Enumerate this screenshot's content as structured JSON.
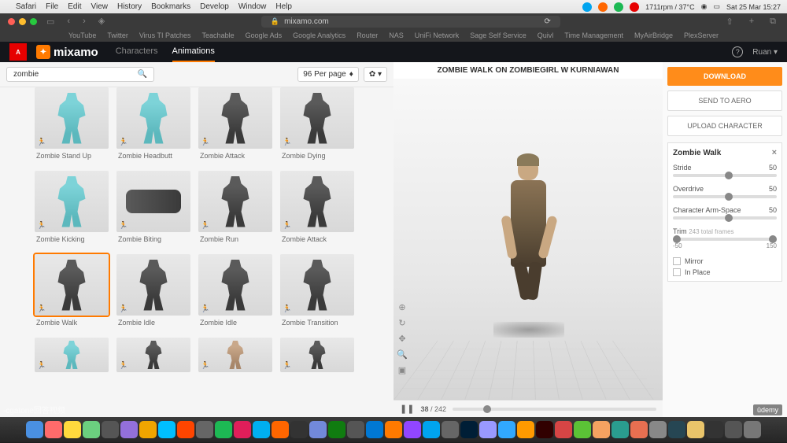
{
  "menubar": {
    "app": "Safari",
    "items": [
      "File",
      "Edit",
      "View",
      "History",
      "Bookmarks",
      "Develop",
      "Window",
      "Help"
    ],
    "status": "1711rpm / 37°C",
    "datetime": "Sat 25 Mar 15:27"
  },
  "browser": {
    "url": "mixamo.com",
    "bookmarks": [
      "YouTube",
      "Twitter",
      "Virus TI Patches",
      "Teachable",
      "Google Ads",
      "Google Analytics",
      "Router",
      "NAS",
      "UniFi Network",
      "Sage Self Service",
      "Quivl",
      "Time Management",
      "MyAirBridge",
      "PlexServer"
    ]
  },
  "header": {
    "logo_text": "mixamo",
    "tabs": [
      {
        "label": "Characters",
        "active": false
      },
      {
        "label": "Animations",
        "active": true
      }
    ],
    "user": "Ruan"
  },
  "search": {
    "query": "zombie",
    "per_page": "96 Per page"
  },
  "cards": [
    {
      "label": "Zombie Stand Up",
      "style": "fig-cyan",
      "short": false,
      "selected": false
    },
    {
      "label": "Zombie Headbutt",
      "style": "fig-cyan",
      "short": false,
      "selected": false
    },
    {
      "label": "Zombie Attack",
      "style": "fig-dark",
      "short": false,
      "selected": false
    },
    {
      "label": "Zombie Dying",
      "style": "fig-dark",
      "short": false,
      "selected": false
    },
    {
      "label": "Zombie Kicking",
      "style": "fig-cyan",
      "short": false,
      "selected": false
    },
    {
      "label": "Zombie Biting",
      "style": "fig-lying",
      "short": false,
      "selected": false
    },
    {
      "label": "Zombie Run",
      "style": "fig-dark",
      "short": false,
      "selected": false
    },
    {
      "label": "Zombie Attack",
      "style": "fig-dark",
      "short": false,
      "selected": false
    },
    {
      "label": "Zombie Walk",
      "style": "fig-dark",
      "short": false,
      "selected": true
    },
    {
      "label": "Zombie Idle",
      "style": "fig-dark",
      "short": false,
      "selected": false
    },
    {
      "label": "Zombie Idle",
      "style": "fig-dark",
      "short": false,
      "selected": false
    },
    {
      "label": "Zombie Transition",
      "style": "fig-dark",
      "short": false,
      "selected": false
    },
    {
      "label": "",
      "style": "fig-cyan",
      "short": true,
      "selected": false
    },
    {
      "label": "",
      "style": "fig-dark",
      "short": true,
      "selected": false
    },
    {
      "label": "",
      "style": "fig-skin",
      "short": true,
      "selected": false
    },
    {
      "label": "",
      "style": "fig-dark",
      "short": true,
      "selected": false
    }
  ],
  "viewport": {
    "title": "ZOMBIE WALK ON ZOMBIEGIRL W KURNIAWAN",
    "frame_current": 38,
    "frame_total": 242
  },
  "panel": {
    "download_label": "DOWNLOAD",
    "send_aero_label": "SEND TO AERO",
    "upload_label": "UPLOAD CHARACTER",
    "anim_name": "Zombie Walk",
    "sliders": [
      {
        "name": "Stride",
        "value": 50,
        "pos": 50
      },
      {
        "name": "Overdrive",
        "value": 50,
        "pos": 50
      },
      {
        "name": "Character Arm-Space",
        "value": 50,
        "pos": 50
      }
    ],
    "trim": {
      "label": "Trim",
      "sub": "243 total frames",
      "min": -50,
      "max": 150
    },
    "checks": [
      {
        "label": "Mirror"
      },
      {
        "label": "In Place"
      }
    ]
  },
  "dock_colors": [
    "#4a90e2",
    "#ff6b6b",
    "#ffd93d",
    "#6bcf7f",
    "#555",
    "#9370db",
    "#f0a500",
    "#00bfff",
    "#ff4500",
    "#666",
    "#1db954",
    "#e01e5a",
    "#00aff0",
    "#ff6600",
    "#333",
    "#7289da",
    "#107c10",
    "#555",
    "#0078d4",
    "#ff7a00",
    "#9146ff",
    "#00a4ef",
    "#666",
    "#001e36",
    "#9999ff",
    "#31a8ff",
    "#ff9a00",
    "#310000",
    "#d64545",
    "#5bc236",
    "#f4a261",
    "#2a9d8f",
    "#e76f51",
    "#888",
    "#264653",
    "#e9c46a",
    "#333",
    "#555",
    "#777"
  ],
  "watermark": "-cgatone回答视频",
  "udemy": "ûdemy"
}
